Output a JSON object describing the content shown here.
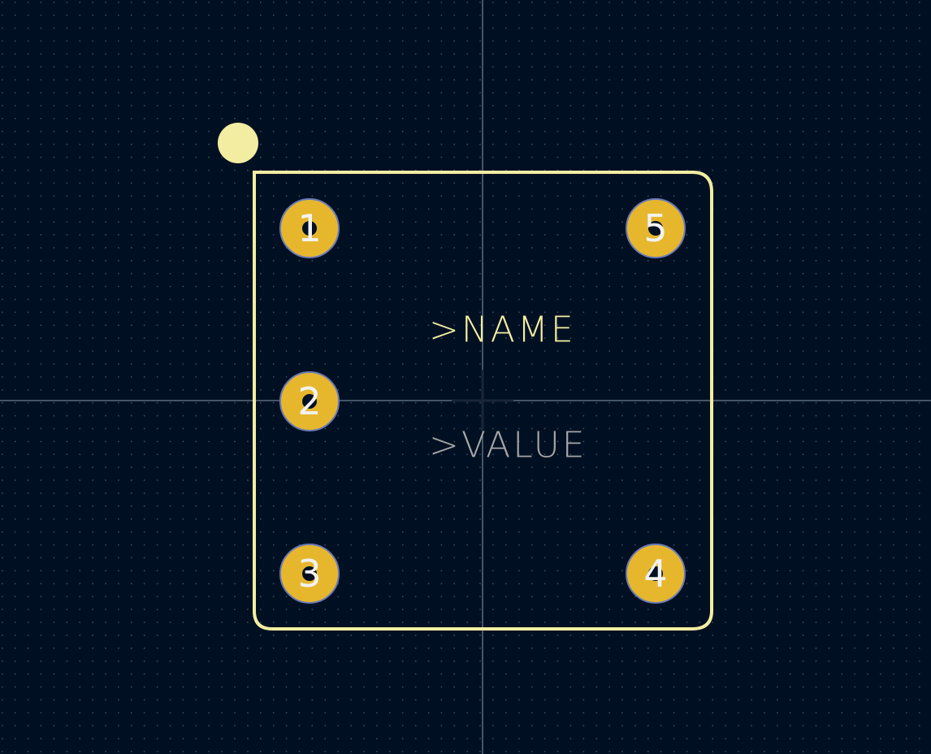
{
  "colors": {
    "background": "#001023",
    "grid_dot": "#3a4a5e",
    "crosshair": "#8a9aae",
    "silkscreen": "#f2eda1",
    "pad_fill": "#e6b72d",
    "pad_outline": "#6a7ab8",
    "pad_number": "#f2f2f2",
    "name_text": "#f2eda1",
    "value_text": "#a6a6a6"
  },
  "footprint": {
    "name_field": ">NAME",
    "value_field": ">VALUE",
    "pin1_marker": "pin1-dot-marker",
    "pads": [
      {
        "number": "1"
      },
      {
        "number": "2"
      },
      {
        "number": "3"
      },
      {
        "number": "4"
      },
      {
        "number": "5"
      }
    ]
  }
}
